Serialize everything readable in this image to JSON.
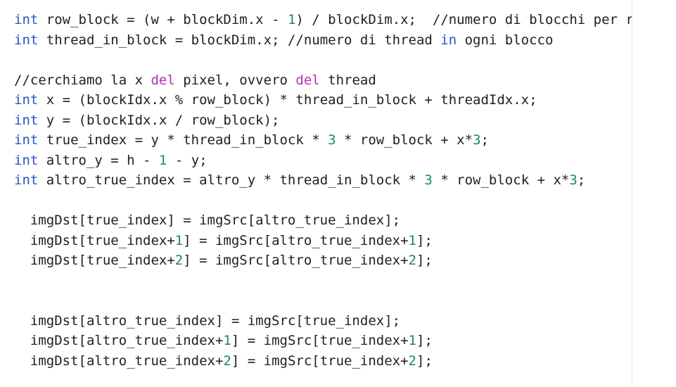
{
  "colors": {
    "keyword": "#2b55c4",
    "number": "#1a8a5a",
    "purple": "#b52fb5",
    "text": "#1f1f1f"
  },
  "code_lines": [
    [
      {
        "t": "int",
        "c": "kw"
      },
      {
        "t": " row_block = (w + blockDim.x - ",
        "c": "plain"
      },
      {
        "t": "1",
        "c": "num"
      },
      {
        "t": ") / blockDim.x;  //numero di blocchi per riga",
        "c": "plain"
      }
    ],
    [
      {
        "t": "int",
        "c": "kw"
      },
      {
        "t": " thread_in_block = blockDim.x; //numero di thread ",
        "c": "plain"
      },
      {
        "t": "in",
        "c": "kw"
      },
      {
        "t": " ogni blocco",
        "c": "plain"
      }
    ],
    [],
    [
      {
        "t": "//cerchiamo la x ",
        "c": "plain"
      },
      {
        "t": "del",
        "c": "purple"
      },
      {
        "t": " pixel, ovvero ",
        "c": "plain"
      },
      {
        "t": "del",
        "c": "purple"
      },
      {
        "t": " thread",
        "c": "plain"
      }
    ],
    [
      {
        "t": "int",
        "c": "kw"
      },
      {
        "t": " x = (blockIdx.x % row_block) * thread_in_block + threadIdx.x;",
        "c": "plain"
      }
    ],
    [
      {
        "t": "int",
        "c": "kw"
      },
      {
        "t": " y = (blockIdx.x / row_block);",
        "c": "plain"
      }
    ],
    [
      {
        "t": "int",
        "c": "kw"
      },
      {
        "t": " true_index = y * thread_in_block * ",
        "c": "plain"
      },
      {
        "t": "3",
        "c": "num"
      },
      {
        "t": " * row_block + x*",
        "c": "plain"
      },
      {
        "t": "3",
        "c": "num"
      },
      {
        "t": ";",
        "c": "plain"
      }
    ],
    [
      {
        "t": "int",
        "c": "kw"
      },
      {
        "t": " altro_y = h - ",
        "c": "plain"
      },
      {
        "t": "1",
        "c": "num"
      },
      {
        "t": " - y;",
        "c": "plain"
      }
    ],
    [
      {
        "t": "int",
        "c": "kw"
      },
      {
        "t": " altro_true_index = altro_y * thread_in_block * ",
        "c": "plain"
      },
      {
        "t": "3",
        "c": "num"
      },
      {
        "t": " * row_block + x*",
        "c": "plain"
      },
      {
        "t": "3",
        "c": "num"
      },
      {
        "t": ";",
        "c": "plain"
      }
    ],
    [],
    [
      {
        "t": "  imgDst[true_index] = imgSrc[altro_true_index];",
        "c": "plain"
      }
    ],
    [
      {
        "t": "  imgDst[true_index+",
        "c": "plain"
      },
      {
        "t": "1",
        "c": "num"
      },
      {
        "t": "] = imgSrc[altro_true_index+",
        "c": "plain"
      },
      {
        "t": "1",
        "c": "num"
      },
      {
        "t": "];",
        "c": "plain"
      }
    ],
    [
      {
        "t": "  imgDst[true_index+",
        "c": "plain"
      },
      {
        "t": "2",
        "c": "num"
      },
      {
        "t": "] = imgSrc[altro_true_index+",
        "c": "plain"
      },
      {
        "t": "2",
        "c": "num"
      },
      {
        "t": "];",
        "c": "plain"
      }
    ],
    [],
    [],
    [
      {
        "t": "  imgDst[altro_true_index] = imgSrc[true_index];",
        "c": "plain"
      }
    ],
    [
      {
        "t": "  imgDst[altro_true_index+",
        "c": "plain"
      },
      {
        "t": "1",
        "c": "num"
      },
      {
        "t": "] = imgSrc[true_index+",
        "c": "plain"
      },
      {
        "t": "1",
        "c": "num"
      },
      {
        "t": "];",
        "c": "plain"
      }
    ],
    [
      {
        "t": "  imgDst[altro_true_index+",
        "c": "plain"
      },
      {
        "t": "2",
        "c": "num"
      },
      {
        "t": "] = imgSrc[true_index+",
        "c": "plain"
      },
      {
        "t": "2",
        "c": "num"
      },
      {
        "t": "];",
        "c": "plain"
      }
    ]
  ]
}
